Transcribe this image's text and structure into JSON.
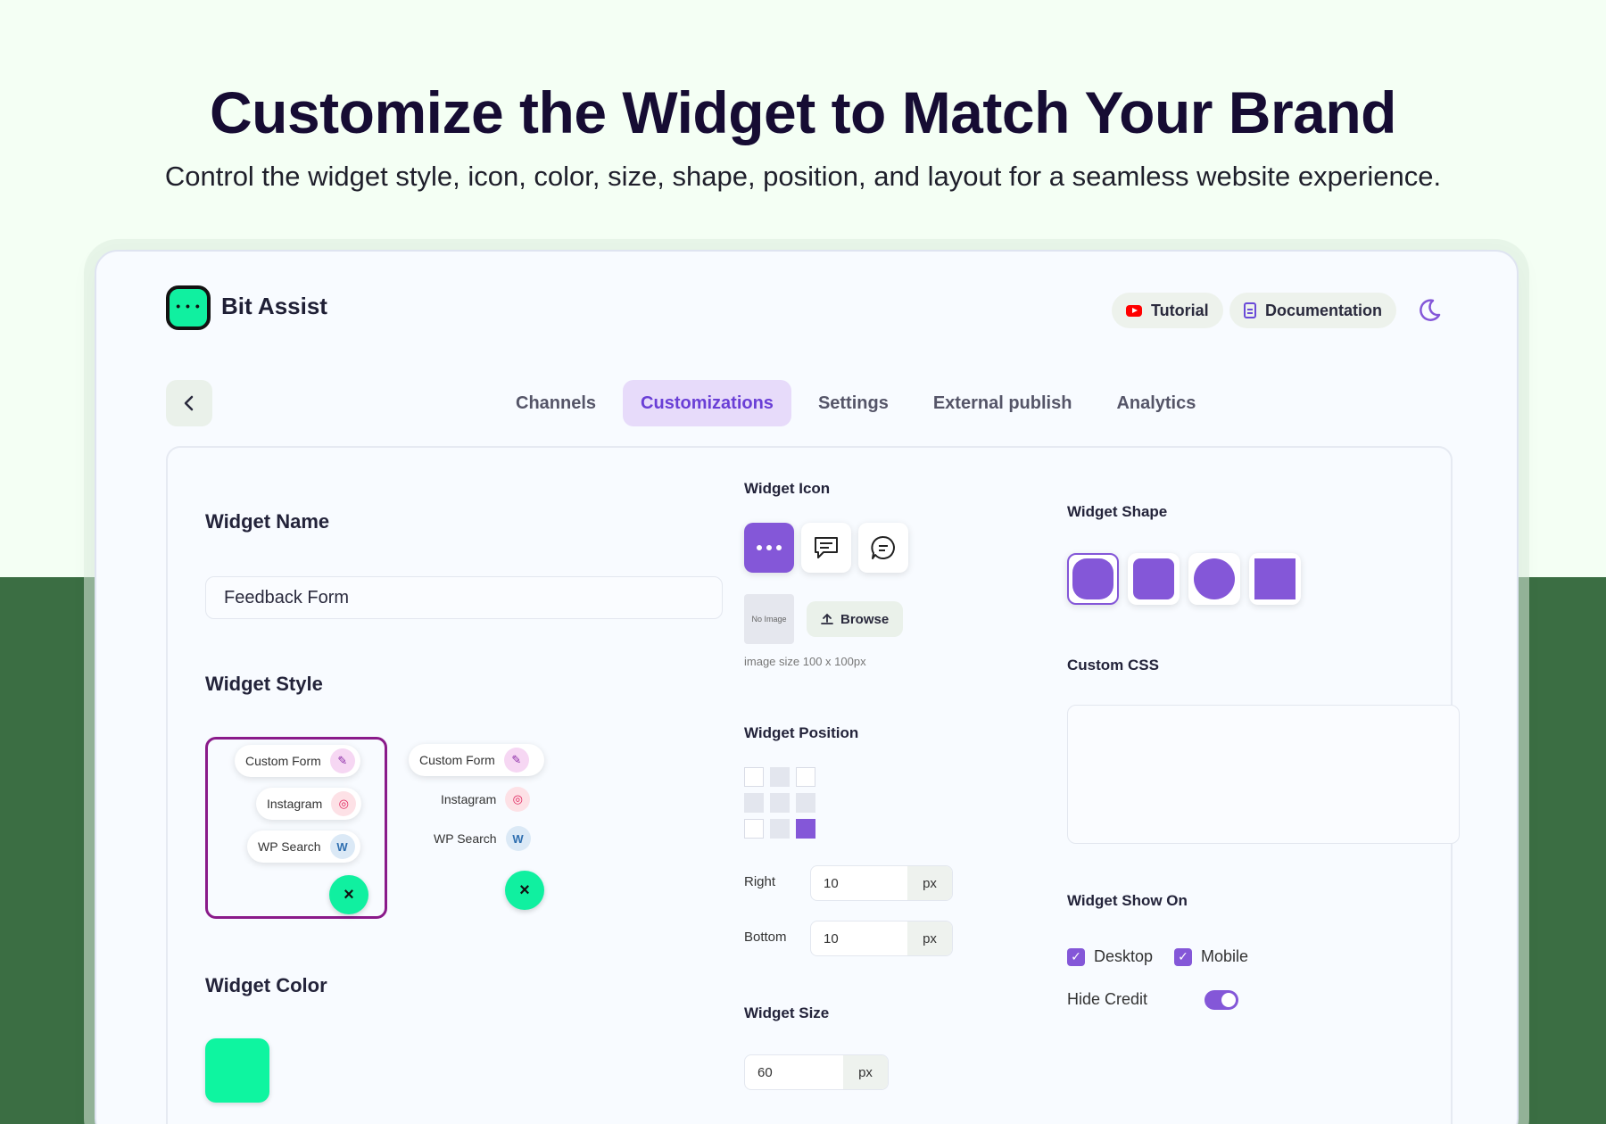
{
  "hero": {
    "title": "Customize the Widget to Match Your Brand",
    "subtitle": "Control the widget style, icon, color, size, shape, position, and layout for a seamless website experience."
  },
  "header": {
    "brand": "Bit Assist",
    "tutorial_label": "Tutorial",
    "documentation_label": "Documentation",
    "icons": [
      "youtube-icon",
      "document-icon",
      "moon-icon"
    ]
  },
  "nav": {
    "back_icon": "chevron-left-icon",
    "tabs": [
      {
        "label": "Channels",
        "active": false
      },
      {
        "label": "Customizations",
        "active": true
      },
      {
        "label": "Settings",
        "active": false
      },
      {
        "label": "External publish",
        "active": false
      },
      {
        "label": "Analytics",
        "active": false
      }
    ]
  },
  "widget_name": {
    "label": "Widget Name",
    "value": "Feedback Form"
  },
  "widget_style": {
    "label": "Widget Style",
    "items": [
      "Custom Form",
      "Instagram",
      "WP Search"
    ],
    "close_icon": "×"
  },
  "widget_color": {
    "label": "Widget Color",
    "value": "#0ef5a0"
  },
  "widget_icon": {
    "label": "Widget Icon",
    "no_image": "No Image",
    "browse_label": "Browse",
    "hint": "image size 100 x 100px"
  },
  "widget_position": {
    "label": "Widget Position",
    "selected": "bottom-right",
    "right_label": "Right",
    "right_value": "10",
    "bottom_label": "Bottom",
    "bottom_value": "10",
    "unit": "px"
  },
  "widget_size": {
    "label": "Widget Size",
    "value": "60",
    "unit": "px"
  },
  "widget_shape": {
    "label": "Widget Shape",
    "selected": "rounded"
  },
  "custom_css": {
    "label": "Custom CSS"
  },
  "widget_show_on": {
    "label": "Widget Show On",
    "desktop_label": "Desktop",
    "mobile_label": "Mobile",
    "hide_credit_label": "Hide Credit",
    "desktop": true,
    "mobile": true,
    "hide_credit": true
  },
  "colors": {
    "accent": "#8457d8",
    "brand": "#10f0a0",
    "band": "#3b6e43"
  }
}
